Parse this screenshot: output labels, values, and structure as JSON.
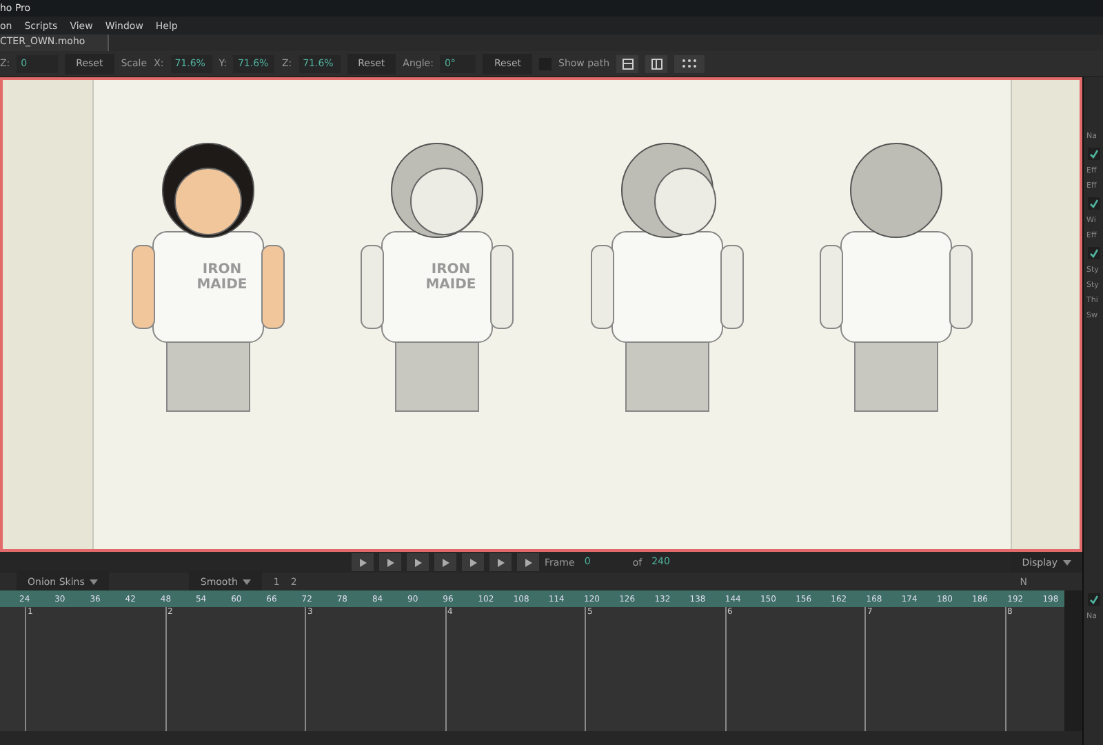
{
  "window": {
    "title": "ho Pro"
  },
  "menu": [
    "on",
    "Scripts",
    "View",
    "Window",
    "Help"
  ],
  "doc_tabs": [
    {
      "label": "CTER_OWN.moho",
      "selected": true
    }
  ],
  "toolbar": {
    "z_label": "Z:",
    "z_value": "0",
    "reset1": "Reset",
    "scale_label": "Scale",
    "x_label": "X:",
    "x_value": "71.6%",
    "y_label": "Y:",
    "y_value": "71.6%",
    "sz_label": "Z:",
    "sz_value": "71.6%",
    "reset2": "Reset",
    "angle_label": "Angle:",
    "angle_value": "0°",
    "reset3": "Reset",
    "show_path": {
      "label": "Show path",
      "checked": false
    }
  },
  "canvas": {
    "characters": [
      {
        "kind": "front",
        "colored": true,
        "shirt_text": [
          "IRON",
          "MAIDE"
        ]
      },
      {
        "kind": "turned",
        "colored": false,
        "shirt_text": [
          "IRON",
          "MAIDE"
        ]
      },
      {
        "kind": "side",
        "colored": false
      },
      {
        "kind": "back",
        "colored": false
      }
    ]
  },
  "playback": {
    "frame_label": "Frame",
    "frame_value": "0",
    "of_label": "of",
    "of_value": "240",
    "display": "Display"
  },
  "timeline_toolbar": {
    "onion": "Onion Skins",
    "smooth": "Smooth",
    "ease": "1",
    "keys": "2",
    "n": "N"
  },
  "ruler": [
    "24",
    "30",
    "36",
    "42",
    "48",
    "54",
    "60",
    "66",
    "72",
    "78",
    "84",
    "90",
    "96",
    "102",
    "108",
    "114",
    "120",
    "126",
    "132",
    "138",
    "144",
    "150",
    "156",
    "162",
    "168",
    "174",
    "180",
    "186",
    "192",
    "198"
  ],
  "frame_markers": [
    "1",
    "2",
    "3",
    "4",
    "5",
    "6",
    "7",
    "8"
  ],
  "side_panel": {
    "items": [
      {
        "kind": "text",
        "label": "Na"
      },
      {
        "kind": "check",
        "checked": true
      },
      {
        "kind": "text",
        "label": "Eff"
      },
      {
        "kind": "text",
        "label": "Eff"
      },
      {
        "kind": "check",
        "checked": true
      },
      {
        "kind": "text",
        "label": "Wi"
      },
      {
        "kind": "text",
        "label": "Eff"
      },
      {
        "kind": "check",
        "checked": true
      },
      {
        "kind": "text",
        "label": "Sty"
      },
      {
        "kind": "text",
        "label": "Sty"
      },
      {
        "kind": "text",
        "label": "Thi"
      },
      {
        "kind": "text",
        "label": "Sw"
      }
    ],
    "bottom_check": {
      "checked": true
    },
    "layers_header": "Na"
  }
}
